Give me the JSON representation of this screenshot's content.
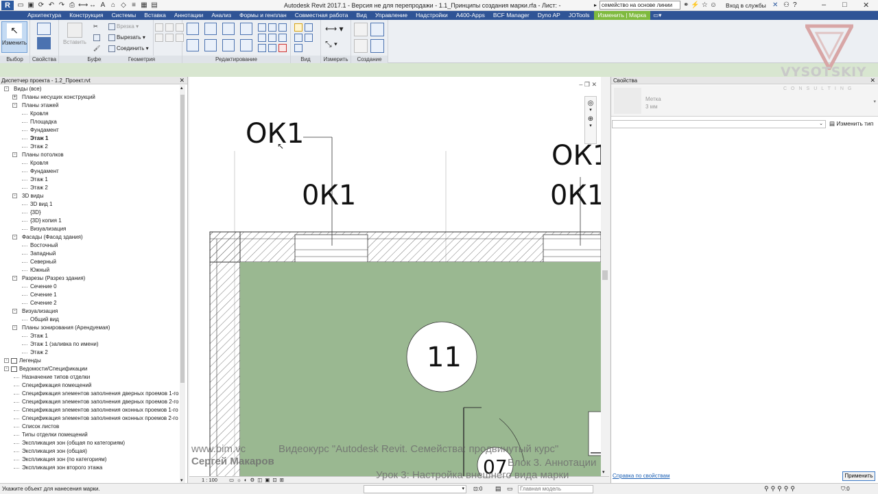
{
  "titlebar": {
    "app_icon_letter": "R",
    "title": "Autodesk Revit 2017.1 - Версия не для перепродажи -    1.1_Принципы создания марки.rfa - Лист: -",
    "search_value": "семейство на основе линии",
    "login": "Вход в службы"
  },
  "tabs": [
    "Архитектура",
    "Конструкция",
    "Системы",
    "Вставка",
    "Аннотации",
    "Анализ",
    "Формы и генплан",
    "Совместная работа",
    "Вид",
    "Управление",
    "Надстройки",
    "A400-Apps",
    "BCF Manager",
    "Dyno AP",
    "JOTools",
    "Изменить | Марка"
  ],
  "ribbon": {
    "modify_label": "Изменить",
    "groups": {
      "select": "Выбор",
      "properties": "Свойства",
      "clipboard": "Буфер обмена",
      "geometry": "Геометрия",
      "edit": "Редактирование",
      "view": "Вид",
      "measure": "Измерить",
      "create": "Создание"
    },
    "paste_label": "Вставить",
    "cut_geometry": "Врезка",
    "cut": "Вырезать",
    "join": "Соединить"
  },
  "browser": {
    "title": "Диспетчер проекта - 1.2_Проект.rvt",
    "nodes": [
      {
        "label": "Виды (все)",
        "level": 0,
        "tog": "-"
      },
      {
        "label": "Планы несущих конструкций",
        "level": 1,
        "tog": "+"
      },
      {
        "label": "Планы этажей",
        "level": 1,
        "tog": "-"
      },
      {
        "label": "Кровля",
        "level": 2
      },
      {
        "label": "Площадка",
        "level": 2
      },
      {
        "label": "Фундамент",
        "level": 2
      },
      {
        "label": "Этаж 1",
        "level": 2,
        "bold": true
      },
      {
        "label": "Этаж 2",
        "level": 2
      },
      {
        "label": "Планы потолков",
        "level": 1,
        "tog": "-"
      },
      {
        "label": "Кровля",
        "level": 2
      },
      {
        "label": "Фундамент",
        "level": 2
      },
      {
        "label": "Этаж 1",
        "level": 2
      },
      {
        "label": "Этаж 2",
        "level": 2
      },
      {
        "label": "3D виды",
        "level": 1,
        "tog": "-"
      },
      {
        "label": "3D вид 1",
        "level": 2
      },
      {
        "label": "{3D}",
        "level": 2
      },
      {
        "label": "{3D} копия 1",
        "level": 2
      },
      {
        "label": "Визуализация",
        "level": 2
      },
      {
        "label": "Фасады (Фасад здания)",
        "level": 1,
        "tog": "-"
      },
      {
        "label": "Восточный",
        "level": 2
      },
      {
        "label": "Западный",
        "level": 2
      },
      {
        "label": "Северный",
        "level": 2
      },
      {
        "label": "Южный",
        "level": 2
      },
      {
        "label": "Разрезы (Разрез здания)",
        "level": 1,
        "tog": "-"
      },
      {
        "label": "Сечение 0",
        "level": 2
      },
      {
        "label": "Сечение 1",
        "level": 2
      },
      {
        "label": "Сечение 2",
        "level": 2
      },
      {
        "label": "Визуализация",
        "level": 1,
        "tog": "-"
      },
      {
        "label": "Общий вид",
        "level": 2
      },
      {
        "label": "Планы зонирования (Арендуемая)",
        "level": 1,
        "tog": "-"
      },
      {
        "label": "Этаж 1",
        "level": 2
      },
      {
        "label": "Этаж 1 (заливка по имени)",
        "level": 2
      },
      {
        "label": "Этаж 2",
        "level": 2
      },
      {
        "label": "Легенды",
        "level": 0,
        "tog": "-",
        "icon": true
      },
      {
        "label": "Ведомости/Спецификации",
        "level": 0,
        "tog": "-",
        "icon": true
      },
      {
        "label": "Назначение типов отделки",
        "level": 1
      },
      {
        "label": "Спецификация помещений",
        "level": 1
      },
      {
        "label": "Спецификация элементов заполнения дверных проемов 1-го э",
        "level": 1
      },
      {
        "label": "Спецификация элементов заполнения дверных проемов 2-го э",
        "level": 1
      },
      {
        "label": "Спецификация элементов заполнения оконных проемов 1-го э",
        "level": 1
      },
      {
        "label": "Спецификация элементов заполнения оконных проемов 2-го э",
        "level": 1
      },
      {
        "label": "Список листов",
        "level": 1
      },
      {
        "label": "Типы отделки помещений",
        "level": 1
      },
      {
        "label": "Экспликация зон (общая по категориям)",
        "level": 1
      },
      {
        "label": "Экспликация зон (общая)",
        "level": 1
      },
      {
        "label": "Экспликация зон (по категориям)",
        "level": 1
      },
      {
        "label": "Экспликация зон второго этажа",
        "level": 1
      }
    ]
  },
  "drawing": {
    "tag_a": "ОК1",
    "tag_b": "0К1",
    "tag_c": "ОК1",
    "tag_d": "0К1",
    "room_number": "11",
    "door_number": "07",
    "scale": "1 : 100"
  },
  "properties": {
    "title": "Свойства",
    "type_name": "Метка",
    "type_size": "3 мм",
    "edit_type": "Изменить тип",
    "help_link": "Справка по свойствам",
    "apply": "Применить"
  },
  "statusbar": {
    "text": "Укажите объект для нанесения марки.",
    "coord": ":0",
    "workset": "Главная модель",
    "filter": ":0"
  },
  "overlay": {
    "brand": "VYSOTSKIY",
    "brand_sub": "CONSULTING",
    "site": "www.bim.vc",
    "course": "Видеокурс \"Autodesk Revit. Семейства: продвинутый курс\"",
    "author": "Сергей Макаров",
    "block": "Блок 3. Аннотации",
    "lesson": "Урок 3: Настройка внешнего вида марки"
  },
  "colors": {
    "tab_bar": "#2f5496",
    "context_tab": "#7fba3e",
    "room_fill": "#9ab891",
    "link": "#1a5fb4"
  }
}
